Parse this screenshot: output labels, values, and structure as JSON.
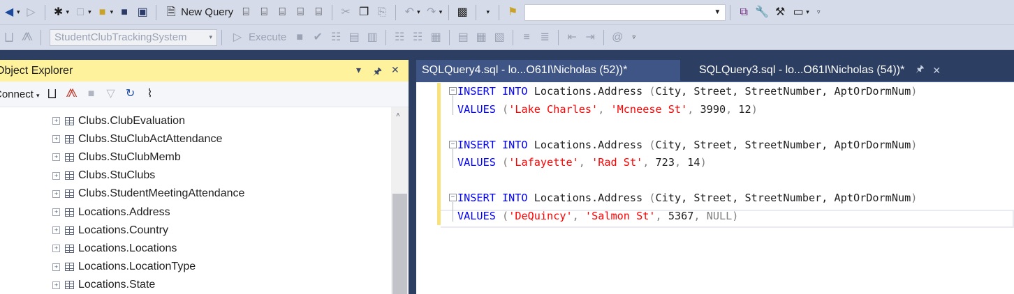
{
  "toolbar_main": {
    "new_query_label": "New Query",
    "search_value": ""
  },
  "toolbar_sql": {
    "database_selector": "StudentClubTrackingSystem",
    "execute_label": "Execute"
  },
  "object_explorer": {
    "title": "Object Explorer",
    "connect_label": "Connect",
    "tree_items": [
      "Clubs.ClubEvaluation",
      "Clubs.StuClubActAttendance",
      "Clubs.StuClubMemb",
      "Clubs.StuClubs",
      "Clubs.StudentMeetingAttendance",
      "Locations.Address",
      "Locations.Country",
      "Locations.Locations",
      "Locations.LocationType",
      "Locations.State"
    ]
  },
  "tabs": [
    {
      "label": "SQLQuery4.sql - lo...O61I\\Nicholas (52))*",
      "active": true
    },
    {
      "label": "SQLQuery3.sql - lo...O61I\\Nicholas (54))*",
      "active": false
    }
  ],
  "editor": {
    "statements": [
      {
        "insert_keywords": "INSERT INTO",
        "table": "Locations.Address",
        "columns": "City, Street, StreetNumber, AptOrDormNum",
        "values_keyword": "VALUES",
        "city": "'Lake Charles'",
        "street": "'Mcneese St'",
        "street_number": "3990",
        "apt": "12"
      },
      {
        "insert_keywords": "INSERT INTO",
        "table": "Locations.Address",
        "columns": "City, Street, StreetNumber, AptOrDormNum",
        "values_keyword": "VALUES",
        "city": "'Lafayette'",
        "street": "'Rad St'",
        "street_number": "723",
        "apt": "14"
      },
      {
        "insert_keywords": "INSERT INTO",
        "table": "Locations.Address",
        "columns": "City, Street, StreetNumber, AptOrDormNum",
        "values_keyword": "VALUES",
        "city": "'DeQuincy'",
        "street": "'Salmon St'",
        "street_number": "5367",
        "apt": "NULL"
      }
    ]
  },
  "colors": {
    "chrome": "#2c3e62",
    "toolbar": "#d6dbe9",
    "active_panel_title": "#fff29d",
    "keyword": "#0000ff",
    "string": "#ff0000",
    "punctuation": "#808080",
    "change_bar": "#f9e27a"
  }
}
